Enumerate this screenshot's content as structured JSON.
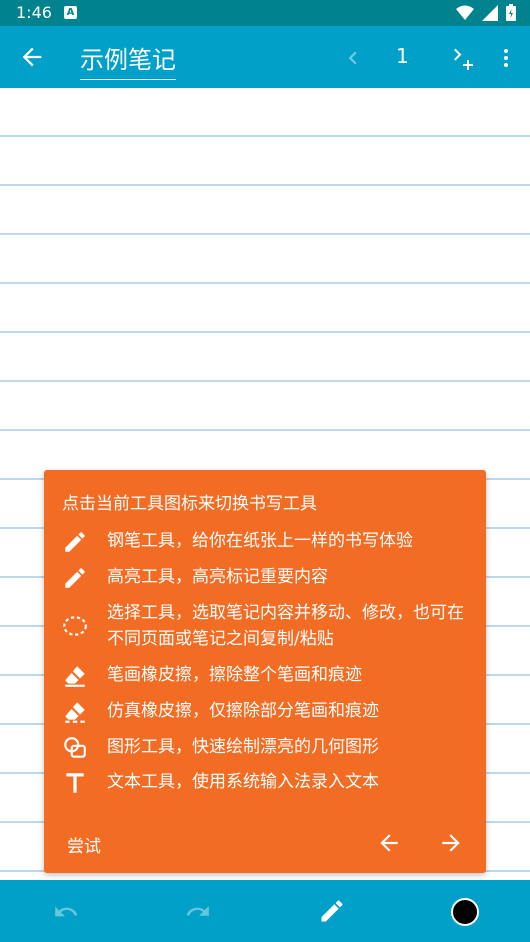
{
  "status_bar": {
    "time": "1:46",
    "notification_letter": "A"
  },
  "app_bar": {
    "note_title": "示例笔记",
    "page_number": "1"
  },
  "popup": {
    "title": "点击当前工具图标来切换书写工具",
    "tips": [
      {
        "icon": "pen-icon",
        "text": "钢笔工具，给你在纸张上一样的书写体验"
      },
      {
        "icon": "highlighter-icon",
        "text": "高亮工具，高亮标记重要内容"
      },
      {
        "icon": "lasso-icon",
        "text": "选择工具，选取笔记内容并移动、修改，也可在不同页面或笔记之间复制/粘贴"
      },
      {
        "icon": "eraser-icon",
        "text": "笔画橡皮擦，擦除整个笔画和痕迹"
      },
      {
        "icon": "eraser-partial-icon",
        "text": "仿真橡皮擦，仅擦除部分笔画和痕迹"
      },
      {
        "icon": "shape-icon",
        "text": "图形工具，快速绘制漂亮的几何图形"
      },
      {
        "icon": "text-icon",
        "text": "文本工具，使用系统输入法录入文本"
      }
    ],
    "try_label": "尝试"
  },
  "colors": {
    "status_bar": "#00838f",
    "app_bar": "#00a0c8",
    "popup": "#f36c24",
    "paper_lines": "#bcd8ee",
    "current_pen_color": "#000000"
  }
}
